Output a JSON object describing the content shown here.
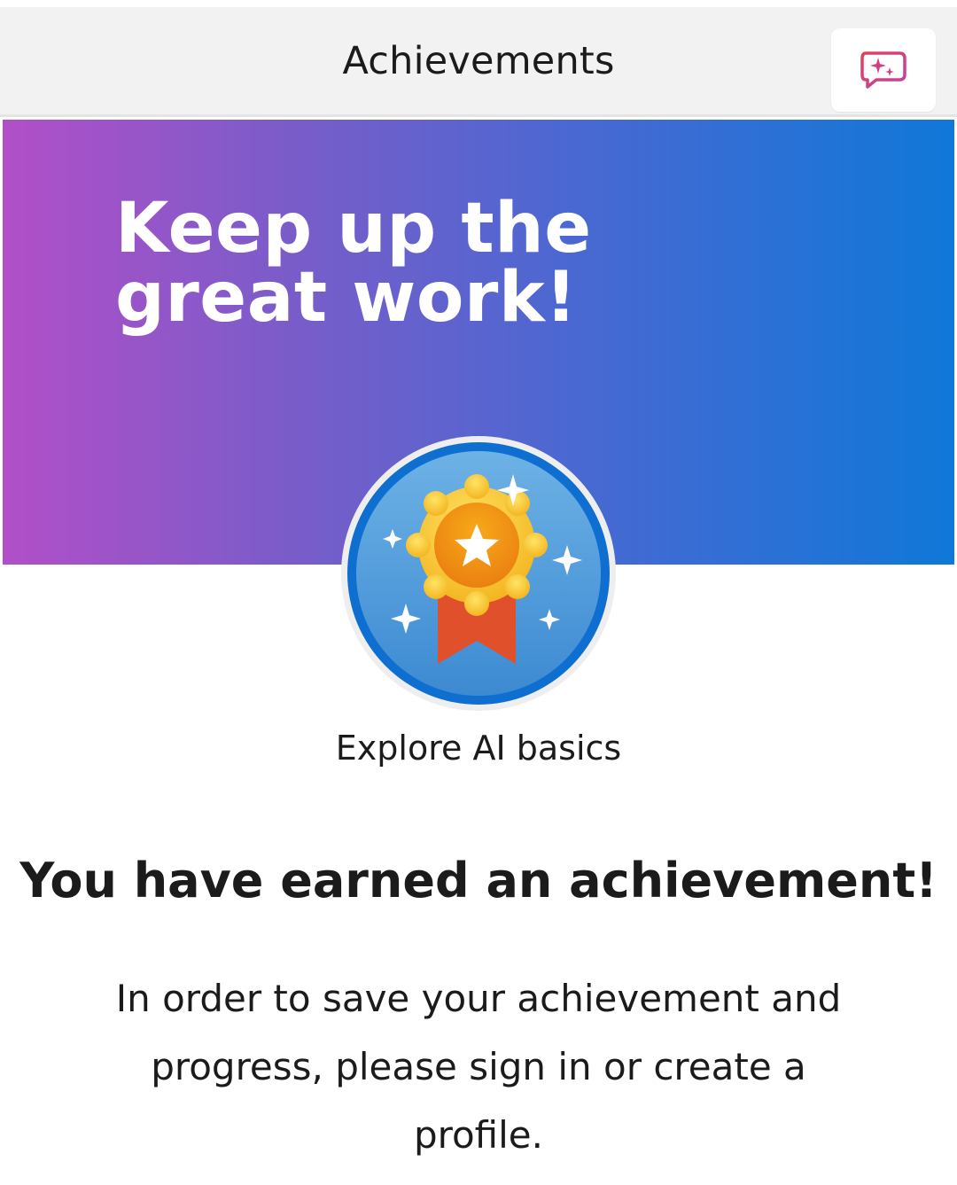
{
  "header": {
    "title": "Achievements",
    "copilot_icon": "chat-sparkle-icon"
  },
  "banner": {
    "headline": "Keep up the great work!"
  },
  "badge": {
    "icon": "award-medal-icon",
    "name": "Explore AI basics"
  },
  "content": {
    "title": "You have earned an achievement!",
    "message": "In order to save your achievement and progress, please sign in or create a profile."
  },
  "colors": {
    "gradient_start": "#b24fc8",
    "gradient_end": "#0f78d8",
    "badge_ring": "#0f6fd0",
    "medal_gold": "#f7c22b",
    "ribbon_red": "#e0512b"
  }
}
